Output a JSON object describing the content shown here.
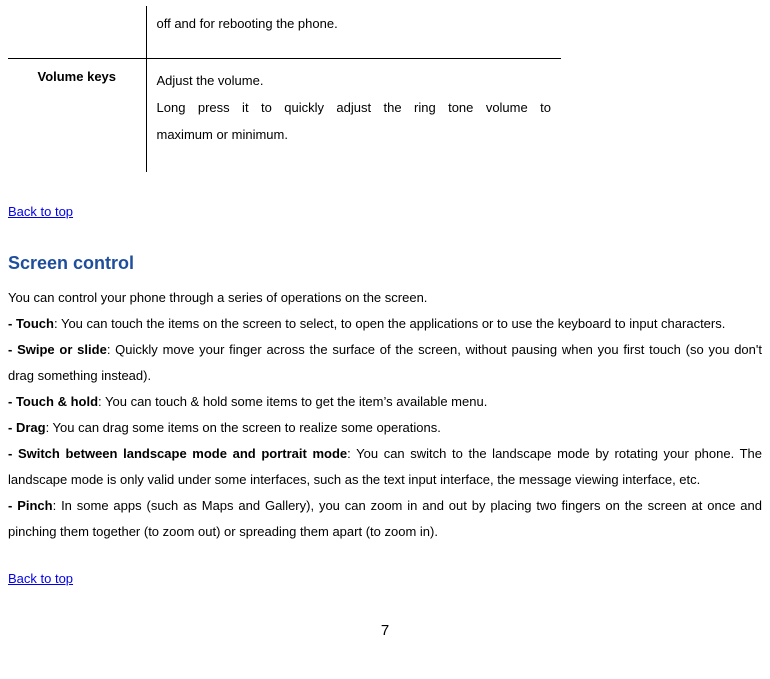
{
  "table": {
    "row1": {
      "desc": "off and for rebooting the phone."
    },
    "row2": {
      "key": "Volume keys",
      "desc_line1": "Adjust the volume.",
      "desc_line2": "Long press it to quickly adjust the ring tone volume to",
      "desc_line3": "maximum or minimum."
    }
  },
  "links": {
    "back_to_top": "Back to top"
  },
  "section": {
    "heading": "Screen control",
    "intro": "You can control your phone through a series of operations on the screen.",
    "touch_label": "- Touch",
    "touch_text": ": You can touch the items on the screen to select, to open the applications or to use the keyboard to input characters.",
    "swipe_label": "- Swipe or slide",
    "swipe_text": ": Quickly move your finger across the surface of the screen, without pausing when you first touch (so you don't drag something instead).",
    "hold_label": "- Touch & hold",
    "hold_text": ": You can touch & hold some items to get the item’s available menu.",
    "drag_label": "- Drag",
    "drag_text": ": You can drag some items on the screen to realize some operations.",
    "mode_label": "- Switch between landscape mode and portrait mode",
    "mode_text": ": You can switch to the landscape mode by rotating your phone. The landscape mode is only valid under some interfaces, such as the text input interface, the message viewing interface, etc.",
    "pinch_label": "- Pinch",
    "pinch_text": ": In some apps (such as Maps and Gallery), you can zoom in and out by placing two fingers on the screen at once and pinching them together (to zoom out) or spreading them apart (to zoom in)."
  },
  "page_number": "7"
}
